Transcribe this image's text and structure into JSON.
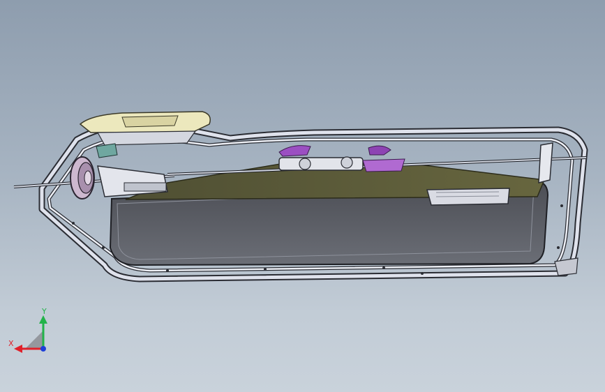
{
  "viewport": {
    "background_top": "#8e9dae",
    "background_bottom": "#c9d2db"
  },
  "model": {
    "frame_color": "#d9dce6",
    "tank_color": "#55585f",
    "deck_color": "#5b5b3c",
    "accent_color": "#9b4fc2",
    "handle_color": "#e8e4b8"
  },
  "triad": {
    "x_label": "X",
    "y_label": "Y",
    "x_color": "#e0202a",
    "y_color": "#22b34a",
    "z_color": "#1d3fd8"
  }
}
